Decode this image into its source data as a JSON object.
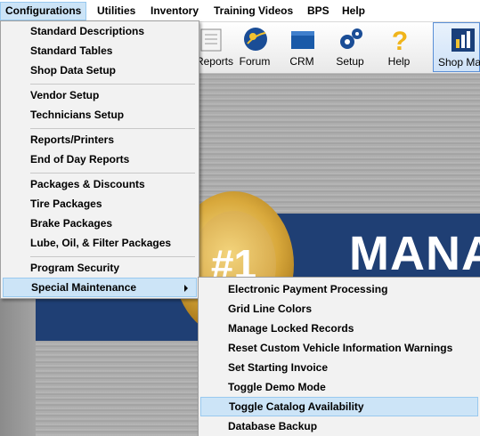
{
  "menubar": {
    "items": [
      "Configurations",
      "Utilities",
      "Inventory",
      "Training Videos",
      "BPS",
      "Help"
    ]
  },
  "toolbar": {
    "buttons": [
      "Reports",
      "Forum",
      "CRM",
      "Setup",
      "Help",
      "Shop Ma"
    ]
  },
  "banner": {
    "text": "MANA",
    "medal_text": "#1"
  },
  "configurations_menu": {
    "items": [
      "Standard Descriptions",
      "Standard Tables",
      "Shop Data Setup",
      "Vendor Setup",
      "Technicians Setup",
      "Reports/Printers",
      "End of Day Reports",
      "Packages & Discounts",
      "Tire Packages",
      "Brake Packages",
      "Lube, Oil, & Filter Packages",
      "Program Security",
      "Special Maintenance"
    ]
  },
  "special_maintenance_menu": {
    "items": [
      "Electronic Payment Processing",
      "Grid Line Colors",
      "Manage Locked Records",
      "Reset Custom Vehicle Information Warnings",
      "Set Starting Invoice",
      "Toggle Demo Mode",
      "Toggle Catalog Availability",
      "Database Backup"
    ]
  },
  "colors": {
    "highlight": "#cce4f7",
    "banner": "#1f3f74",
    "accent": "#1f4e8c"
  }
}
